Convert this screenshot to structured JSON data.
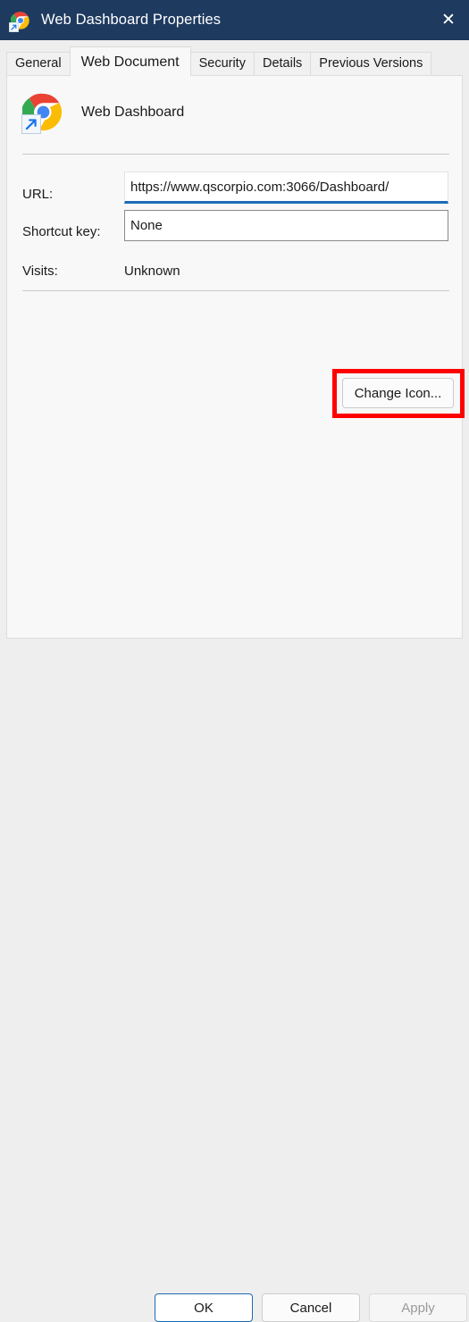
{
  "window": {
    "title": "Web Dashboard Properties",
    "icon": "chrome-shortcut-icon",
    "close_label": "✕",
    "titlebar_color": "#1e3a5f"
  },
  "tabs": [
    {
      "label": "General",
      "active": false
    },
    {
      "label": "Web Document",
      "active": true
    },
    {
      "label": "Security",
      "active": false
    },
    {
      "label": "Details",
      "active": false
    },
    {
      "label": "Previous Versions",
      "active": false
    }
  ],
  "document": {
    "icon": "chrome-shortcut-icon",
    "name": "Web Dashboard"
  },
  "fields": {
    "url": {
      "label": "URL:",
      "value": "https://www.qscorpio.com:3066/Dashboard/",
      "placeholder": "",
      "focused": true,
      "focus_color": "#1a6bb5"
    },
    "shortcut_key": {
      "label": "Shortcut key:",
      "value": "None",
      "placeholder": "",
      "focused": false
    },
    "visits": {
      "label": "Visits:",
      "value": "Unknown"
    }
  },
  "actions": {
    "change_icon_label": "Change Icon...",
    "highlight_color": "#ff0000"
  },
  "footer": {
    "ok_label": "OK",
    "cancel_label": "Cancel",
    "apply_label": "Apply",
    "apply_disabled": true
  }
}
